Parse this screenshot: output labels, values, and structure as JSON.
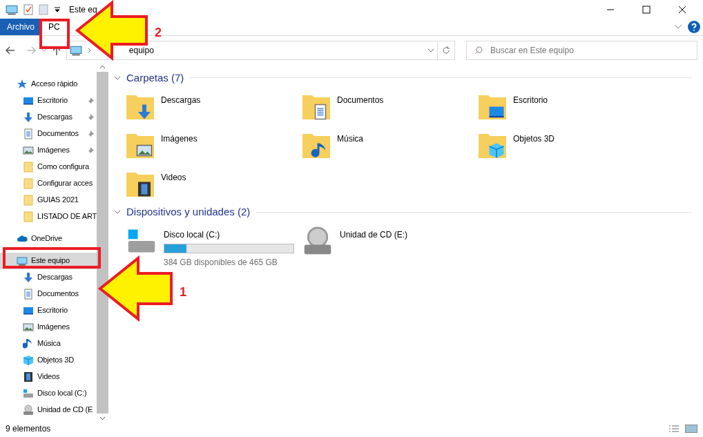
{
  "window": {
    "title": "Este eq"
  },
  "ribbon": {
    "tabs": [
      {
        "label": "Archivo",
        "kind": "file"
      },
      {
        "label": "PC",
        "kind": "tab"
      }
    ]
  },
  "address": {
    "path": "equipo"
  },
  "search": {
    "placeholder": "Buscar en Este equipo"
  },
  "sidebar": {
    "items": [
      {
        "label": "Acceso rápido",
        "kind": "star",
        "selected": false,
        "children": [
          {
            "label": "Escritorio",
            "kind": "desktop",
            "pinned": true,
            "selected": false
          },
          {
            "label": "Descargas",
            "kind": "download",
            "pinned": true,
            "selected": false
          },
          {
            "label": "Documentos",
            "kind": "document",
            "pinned": true,
            "selected": false
          },
          {
            "label": "Imágenes",
            "kind": "pictures",
            "pinned": true,
            "selected": false
          },
          {
            "label": "Como configura",
            "kind": "folder",
            "pinned": false,
            "selected": false
          },
          {
            "label": "Configurar acces",
            "kind": "folder",
            "pinned": false,
            "selected": false
          },
          {
            "label": "GUIAS 2021",
            "kind": "folder",
            "pinned": false,
            "selected": false
          },
          {
            "label": "LISTADO DE ART",
            "kind": "folder",
            "pinned": false,
            "selected": false
          }
        ]
      },
      {
        "label": "OneDrive",
        "kind": "cloud",
        "selected": false
      },
      {
        "label": "Este equipo",
        "kind": "pc",
        "selected": true,
        "children": [
          {
            "label": "Descargas",
            "kind": "download",
            "selected": false
          },
          {
            "label": "Documentos",
            "kind": "document",
            "selected": false
          },
          {
            "label": "Escritorio",
            "kind": "desktop",
            "selected": false
          },
          {
            "label": "Imágenes",
            "kind": "pictures",
            "selected": false
          },
          {
            "label": "Música",
            "kind": "music",
            "selected": false
          },
          {
            "label": "Objetos 3D",
            "kind": "cube",
            "selected": false
          },
          {
            "label": "Videos",
            "kind": "video",
            "selected": false
          },
          {
            "label": "Disco local (C:)",
            "kind": "drive",
            "selected": false
          },
          {
            "label": "Unidad de CD (E",
            "kind": "cd",
            "selected": false
          }
        ]
      }
    ]
  },
  "sections": [
    {
      "title": "Carpetas (7)",
      "kind": "folders",
      "items": [
        {
          "name": "Descargas",
          "kind": "download"
        },
        {
          "name": "Documentos",
          "kind": "document"
        },
        {
          "name": "Escritorio",
          "kind": "desktop"
        },
        {
          "name": "Imágenes",
          "kind": "pictures"
        },
        {
          "name": "Música",
          "kind": "music"
        },
        {
          "name": "Objetos 3D",
          "kind": "cube"
        },
        {
          "name": "Videos",
          "kind": "video"
        }
      ]
    },
    {
      "title": "Dispositivos y unidades (2)",
      "kind": "drives",
      "items": [
        {
          "name": "Disco local (C:)",
          "kind": "drive",
          "level": 0.17,
          "detail": "384 GB disponibles de 465 GB"
        },
        {
          "name": "Unidad de CD (E:)",
          "kind": "cd"
        }
      ]
    }
  ],
  "status_bar": {
    "text": "9 elementos"
  },
  "annotations": [
    {
      "label": "2"
    },
    {
      "label": "1"
    }
  ]
}
